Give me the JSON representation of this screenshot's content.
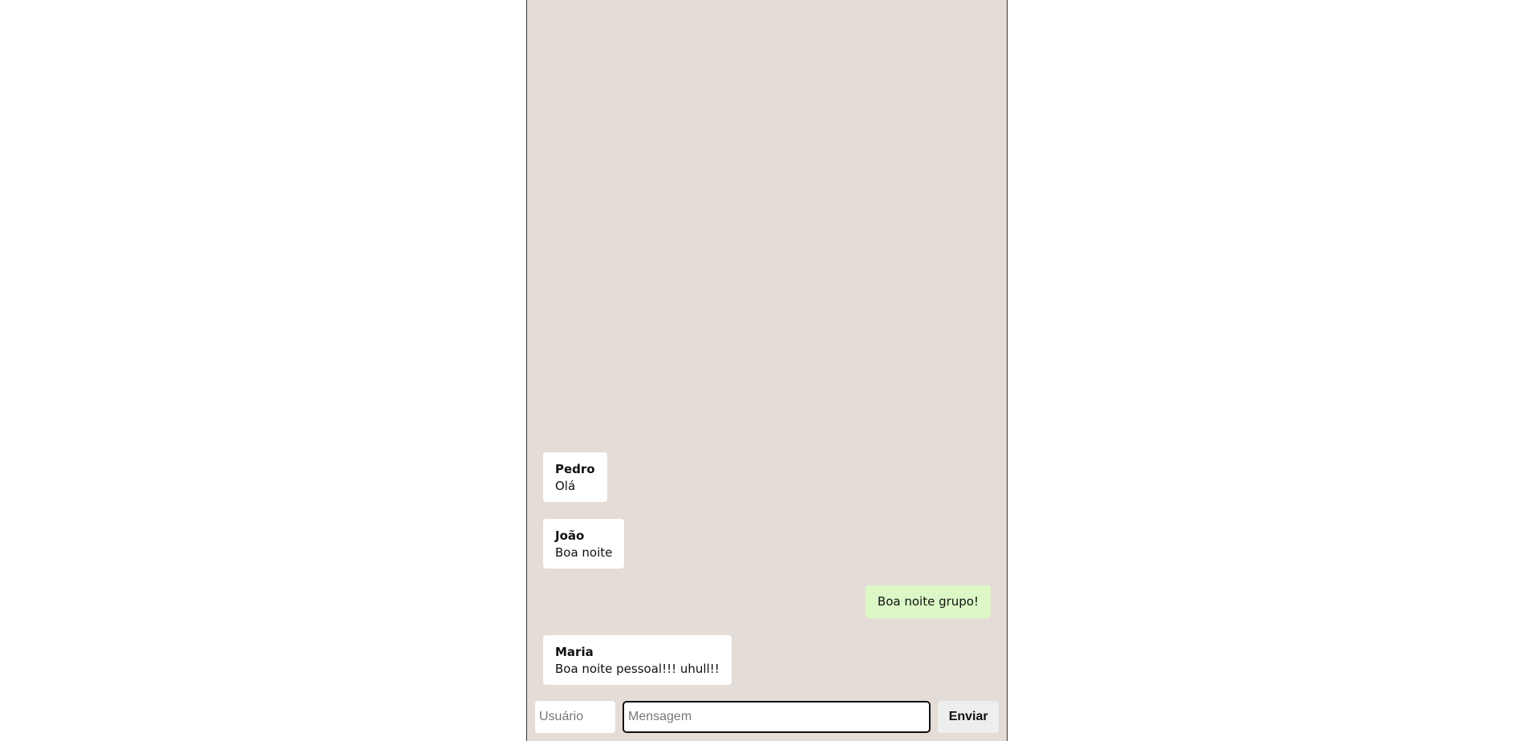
{
  "messages": [
    {
      "author": "Pedro",
      "text": "Olá",
      "own": false
    },
    {
      "author": "João",
      "text": "Boa noite",
      "own": false
    },
    {
      "author": "",
      "text": "Boa noite grupo!",
      "own": true
    },
    {
      "author": "Maria",
      "text": "Boa noite pessoal!!! uhull!!",
      "own": false
    }
  ],
  "composer": {
    "user_placeholder": "Usuário",
    "user_value": "",
    "message_placeholder": "Mensagem",
    "message_value": "",
    "send_label": "Enviar"
  },
  "colors": {
    "chat_background": "#e4dcd6",
    "own_message": "#dcf8c6",
    "other_message": "#ffffff"
  }
}
